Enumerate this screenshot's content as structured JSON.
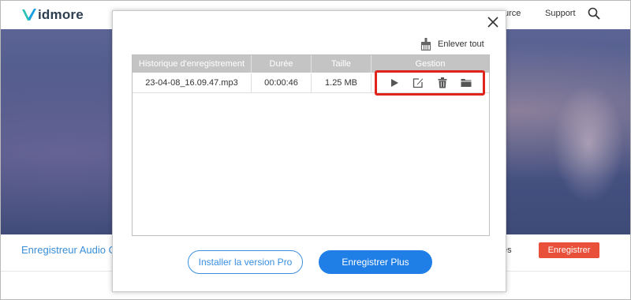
{
  "site": {
    "brand": "idmore",
    "nav_partial": "urce",
    "nav_support": "Support",
    "bottom_title": "Enregistreur Audio G",
    "bottom_partial": "es",
    "bottom_button": "Enregistrer",
    "accent_color": "#e8503a",
    "brand_color": "#2d3e50",
    "link_color": "#3a8fd6"
  },
  "dialog": {
    "remove_all_label": "Enlever tout",
    "columns": [
      "Historique d'enregistrement",
      "Durée",
      "Taille",
      "Gestion"
    ],
    "rows": [
      {
        "file": "23-04-08_16.09.47.mp3",
        "duration": "00:00:46",
        "size": "1.25 MB",
        "actions": [
          "play-icon",
          "edit-icon",
          "trash-icon",
          "folder-icon"
        ]
      }
    ],
    "install_pro_label": "Installer la version Pro",
    "record_more_label": "Enregistrer Plus",
    "highlight_color": "#e0231b",
    "primary_color": "#1f7fe6"
  }
}
